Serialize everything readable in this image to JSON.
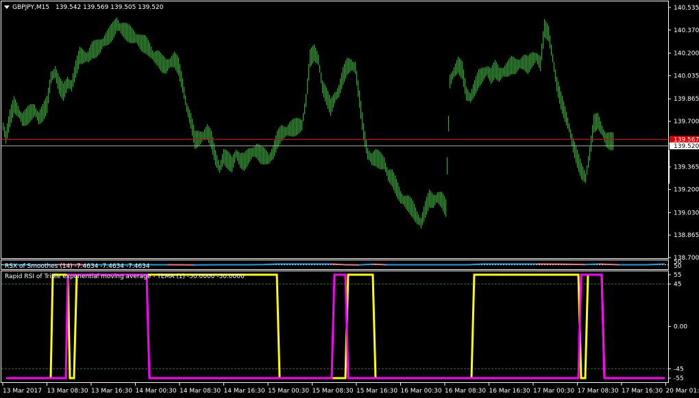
{
  "main_panel": {
    "symbol": "GBPJPY,M15",
    "ohlc": "139.542 139.569 139.505 139.520",
    "bid_line_label": "139.567",
    "price_label": "139.520",
    "colors": {
      "bars": "#3fa33f",
      "bid_line": "#e00000",
      "price_line": "#b0b0b0",
      "bid_tag": "#e00000"
    }
  },
  "rsx_panel": {
    "title": "RSX of Smoothes (14) -7.4634 -7.4634 -7.4634",
    "axis_labels": [
      "50",
      "50"
    ],
    "colors": {
      "up": "#1ea0e6",
      "down": "#e87a8a",
      "dashed": "#ffffff"
    }
  },
  "rapid_panel": {
    "title": "Rapid RSI of Triple exponential moving average - TEMA (1) -50.0000 -50.0000",
    "colors": {
      "yellow": "#ffff00",
      "magenta": "#ff00ff",
      "level_line": "#2a7a2a"
    }
  },
  "x_axis": {
    "labels": [
      "13 Mar 2017",
      "13 Mar 08:30",
      "13 Mar 16:30",
      "14 Mar 00:30",
      "14 Mar 08:30",
      "14 Mar 16:30",
      "15 Mar 00:30",
      "15 Mar 08:30",
      "15 Mar 16:30",
      "16 Mar 00:30",
      "16 Mar 08:30",
      "16 Mar 16:30",
      "17 Mar 00:30",
      "17 Mar 08:30",
      "17 Mar 16:30",
      "20 Mar 01:30"
    ]
  },
  "chart_data": [
    {
      "type": "line",
      "title": "GBPJPY,M15",
      "ylim": [
        138.7,
        140.57
      ],
      "y_ticks": [
        "140.535",
        "140.370",
        "140.200",
        "140.035",
        "139.865",
        "139.700",
        "139.535",
        "139.365",
        "139.200",
        "139.030",
        "138.865",
        "138.700"
      ],
      "y_tick_values": [
        140.535,
        140.37,
        140.2,
        140.035,
        139.865,
        139.7,
        139.535,
        139.365,
        139.2,
        139.03,
        138.865,
        138.7
      ],
      "bid": 139.567,
      "last": 139.52,
      "x_index": [
        0,
        4,
        10,
        16,
        22,
        28,
        34,
        40,
        46,
        52,
        58,
        64,
        70,
        76,
        82,
        88,
        94,
        100,
        106,
        112,
        118,
        124,
        130,
        136,
        142,
        148,
        154,
        160,
        166,
        172,
        178,
        184,
        190,
        196,
        202,
        208,
        214,
        220,
        226,
        232,
        238,
        244,
        250,
        256,
        262,
        268,
        274,
        280,
        286,
        292,
        298,
        304,
        310,
        316,
        322,
        328,
        334,
        340,
        346,
        352,
        358,
        364,
        370,
        376,
        382,
        388,
        394,
        400,
        406,
        412,
        418,
        424,
        430,
        436,
        442,
        448,
        454,
        460,
        466,
        472,
        478,
        484,
        490,
        496,
        502,
        508,
        514,
        520,
        526,
        532,
        538,
        544,
        550,
        556,
        562,
        568,
        574,
        580,
        586,
        592,
        598,
        604,
        610,
        616,
        622,
        628,
        634,
        640,
        646,
        652,
        658,
        664,
        670,
        676,
        682,
        688,
        694,
        700,
        706,
        712,
        718,
        724,
        730,
        736,
        742,
        748,
        754,
        760,
        766,
        772,
        778,
        784,
        790,
        796,
        802,
        808,
        814,
        820,
        826,
        832,
        838,
        844,
        850,
        856,
        862,
        868,
        874,
        880,
        886,
        892,
        898,
        904,
        910,
        916,
        922,
        928,
        934,
        940,
        946,
        952,
        958,
        964
      ],
      "close": [
        139.66,
        139.58,
        139.72,
        139.82,
        139.77,
        139.71,
        139.73,
        139.76,
        139.78,
        139.72,
        139.76,
        139.82,
        140.02,
        140.06,
        139.96,
        139.91,
        139.98,
        139.96,
        140.08,
        140.18,
        140.17,
        140.17,
        140.22,
        140.23,
        140.25,
        140.29,
        140.32,
        140.36,
        140.41,
        140.38,
        140.36,
        140.34,
        140.32,
        140.3,
        140.27,
        140.26,
        140.22,
        140.17,
        140.16,
        140.12,
        140.1,
        140.13,
        140.15,
        140.1,
        139.96,
        139.8,
        139.7,
        139.56,
        139.57,
        139.59,
        139.62,
        139.56,
        139.43,
        139.35,
        139.44,
        139.41,
        139.38,
        139.46,
        139.41,
        139.4,
        139.44,
        139.47,
        139.48,
        139.45,
        139.44,
        139.42,
        139.47,
        139.56,
        139.61,
        139.62,
        139.64,
        139.65,
        139.66,
        139.67,
        139.85,
        140.16,
        140.2,
        140.15,
        139.95,
        139.88,
        139.8,
        139.87,
        139.92,
        140.03,
        140.1,
        140.11,
        140.09,
        139.86,
        139.62,
        139.46,
        139.42,
        139.43,
        139.41,
        139.39,
        139.3,
        139.28,
        139.21,
        139.14,
        139.11,
        139.09,
        139.05,
        138.99,
        138.95,
        139.05,
        139.13,
        139.11,
        139.14,
        139.12,
        139.06,
        139.99,
        140.06,
        140.11,
        140.07,
        139.9,
        139.87,
        139.94,
        140.01,
        140.04,
        140.07,
        140.03,
        140.08,
        140.04,
        140.06,
        140.08,
        140.11,
        140.1,
        140.12,
        140.13,
        140.11,
        140.15,
        140.17,
        140.12,
        140.38,
        140.34,
        140.16,
        139.97,
        139.85,
        139.75,
        139.65,
        139.52,
        139.42,
        139.33,
        139.28,
        139.46,
        139.68,
        139.7,
        139.63,
        139.56,
        139.55
      ]
    },
    {
      "type": "line",
      "title": "RSX of Smoothes (14) -7.4634 -7.4634 -7.4634",
      "ylim": [
        0,
        100
      ],
      "x_index": [
        0,
        40,
        80,
        120,
        160,
        200,
        240,
        280,
        320,
        360,
        380,
        400,
        440,
        480,
        500,
        520,
        540,
        560,
        600,
        640,
        680,
        700,
        740,
        780,
        820,
        850,
        870,
        900,
        940,
        966
      ],
      "values": [
        50,
        50,
        52,
        50,
        50,
        50,
        50,
        48,
        50,
        50,
        52,
        60,
        60,
        60,
        50,
        48,
        58,
        50,
        50,
        50,
        50,
        60,
        60,
        60,
        58,
        52,
        60,
        50,
        50,
        60
      ]
    },
    {
      "type": "line",
      "title": "Rapid RSI of Triple exponential moving average - TEMA (1) -50.0000 -50.0000",
      "ylim": [
        -55,
        55
      ],
      "y_ticks": [
        "55",
        "45",
        "0.00",
        "-45",
        "-55"
      ],
      "y_tick_values": [
        55,
        45,
        0,
        -45,
        -55
      ],
      "levels": [
        45,
        -45
      ],
      "series": [
        {
          "color": "#ffff00",
          "x_index": [
            5,
            70,
            73,
            95,
            98,
            104,
            108,
            400,
            404,
            480,
            484,
            500,
            504,
            540,
            544,
            684,
            688,
            840,
            844,
            850,
            854,
            874,
            878,
            966
          ],
          "values": [
            -55,
            -55,
            55,
            55,
            -55,
            -55,
            55,
            55,
            -55,
            -55,
            -55,
            -55,
            55,
            55,
            -55,
            -55,
            55,
            55,
            -55,
            -55,
            55,
            55,
            -55,
            -55
          ]
        },
        {
          "color": "#ff00ff",
          "x_index": [
            5,
            92,
            95,
            210,
            214,
            480,
            484,
            500,
            504,
            540,
            544,
            840,
            844,
            874,
            878,
            966
          ],
          "values": [
            -55,
            -55,
            55,
            55,
            -55,
            -55,
            55,
            55,
            -55,
            -55,
            -55,
            -55,
            55,
            55,
            -55,
            -55
          ]
        }
      ]
    }
  ]
}
